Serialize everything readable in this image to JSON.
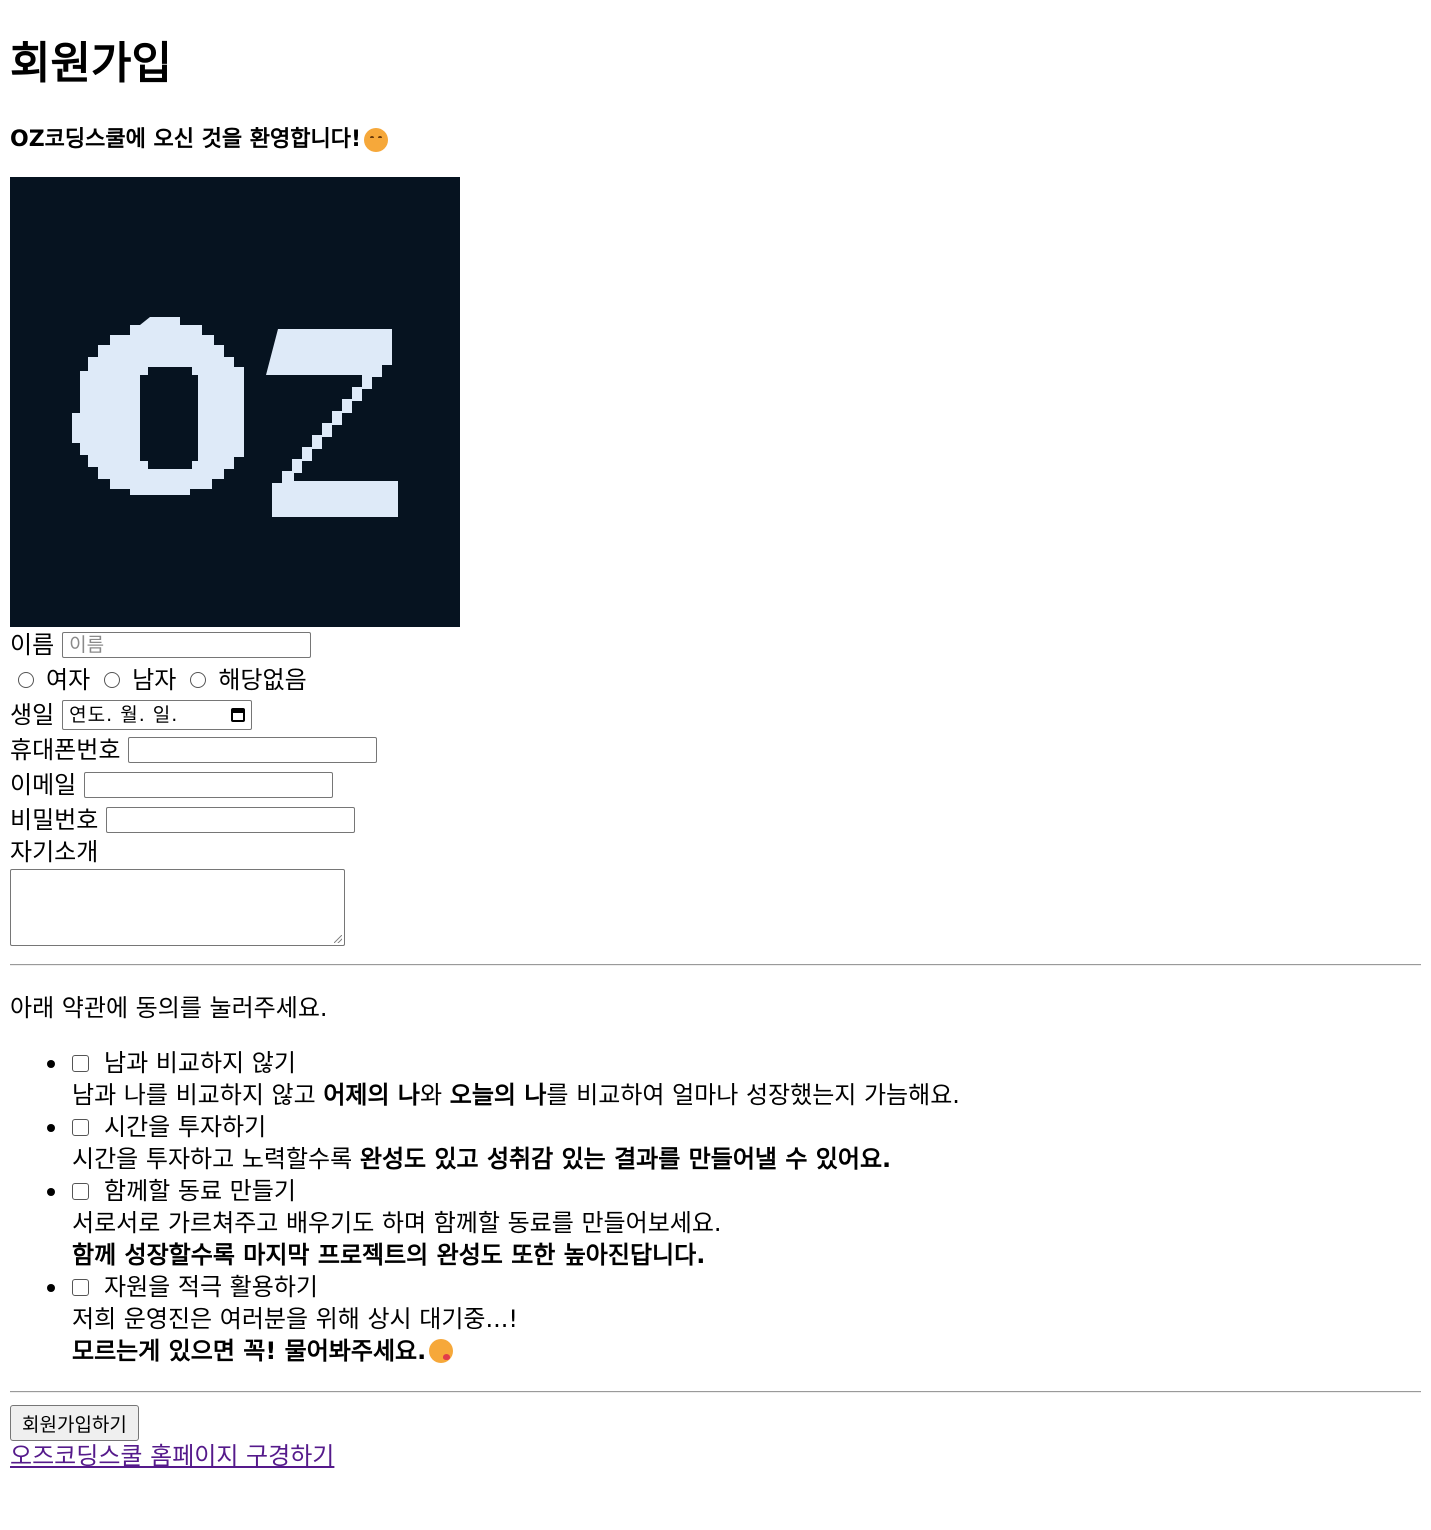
{
  "page": {
    "title": "회원가입",
    "welcome": "OZ코딩스쿨에 오신 것을 환영합니다!",
    "welcome_emoji": "hugging-face-icon"
  },
  "logo": {
    "text": "OZ",
    "background_color": "#061320",
    "letter_color": "#deeaf8"
  },
  "form": {
    "name_label": "이름",
    "name_placeholder": "이름",
    "gender_options": [
      "여자",
      "남자",
      "해당없음"
    ],
    "birthday_label": "생일",
    "birthday_placeholder": "연도. 월. 일.",
    "phone_label": "휴대폰번호",
    "email_label": "이메일",
    "password_label": "비밀번호",
    "intro_label": "자기소개"
  },
  "terms": {
    "intro": "아래 약관에 동의를 눌러주세요.",
    "items": [
      {
        "title": "남과 비교하지 않기",
        "desc_parts": [
          "남과 나를 비교하지 않고 ",
          "어제의 나",
          "와 ",
          "오늘의 나",
          "를 비교하여 얼마나 성장했는지 가늠해요."
        ]
      },
      {
        "title": "시간을 투자하기",
        "desc_parts": [
          "시간을 투자하고 노력할수록 ",
          "완성도 있고 성취감 있는 결과를 만들어낼 수 있어요."
        ]
      },
      {
        "title": "함께할 동료 만들기",
        "desc_parts": [
          "서로서로 가르쳐주고 배우기도 하며 함께할 동료를 만들어보세요.",
          "함께 성장할수록 마지막 프로젝트의 완성도 또한 높아진답니다."
        ]
      },
      {
        "title": "자원을 적극 활용하기",
        "desc_parts": [
          "저희 운영진은 여러분을 위해 상시 대기중...!",
          "모르는게 있으면 꼭! 물어봐주세요."
        ],
        "emoji": "kissing-face-icon"
      }
    ]
  },
  "actions": {
    "submit_label": "회원가입하기",
    "home_link_label": "오즈코딩스쿨 홈페이지 구경하기"
  }
}
